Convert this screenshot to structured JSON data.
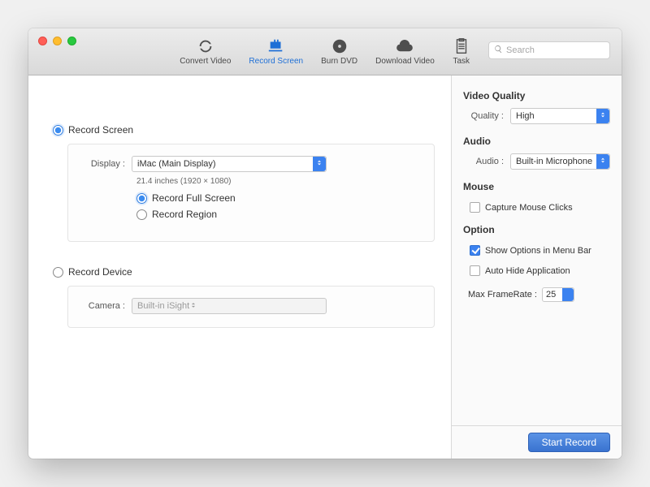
{
  "toolbar": {
    "items": [
      {
        "label": "Convert Video",
        "icon": "convert-icon"
      },
      {
        "label": "Record Screen",
        "icon": "record-icon"
      },
      {
        "label": "Burn DVD",
        "icon": "disc-icon"
      },
      {
        "label": "Download Video",
        "icon": "download-icon"
      },
      {
        "label": "Task",
        "icon": "task-icon"
      }
    ],
    "active_index": 1,
    "search_placeholder": "Search"
  },
  "main": {
    "record_screen": {
      "label": "Record Screen",
      "checked": true,
      "display_label": "Display :",
      "display_value": "iMac (Main Display)",
      "display_info": "21.4 inches (1920 × 1080)",
      "mode_full": {
        "label": "Record Full Screen",
        "checked": true
      },
      "mode_region": {
        "label": "Record Region",
        "checked": false
      }
    },
    "record_device": {
      "label": "Record Device",
      "checked": false,
      "camera_label": "Camera :",
      "camera_value": "Built-in iSight"
    }
  },
  "side": {
    "video_quality": {
      "heading": "Video Quality",
      "label": "Quality :",
      "value": "High"
    },
    "audio": {
      "heading": "Audio",
      "label": "Audio :",
      "value": "Built-in Microphone"
    },
    "mouse": {
      "heading": "Mouse",
      "capture_label": "Capture Mouse Clicks",
      "capture_checked": false
    },
    "option": {
      "heading": "Option",
      "show_menu": {
        "label": "Show Options in Menu Bar",
        "checked": true
      },
      "auto_hide": {
        "label": "Auto Hide Application",
        "checked": false
      },
      "framerate_label": "Max FrameRate :",
      "framerate_value": "25"
    }
  },
  "footer": {
    "start_label": "Start Record"
  }
}
